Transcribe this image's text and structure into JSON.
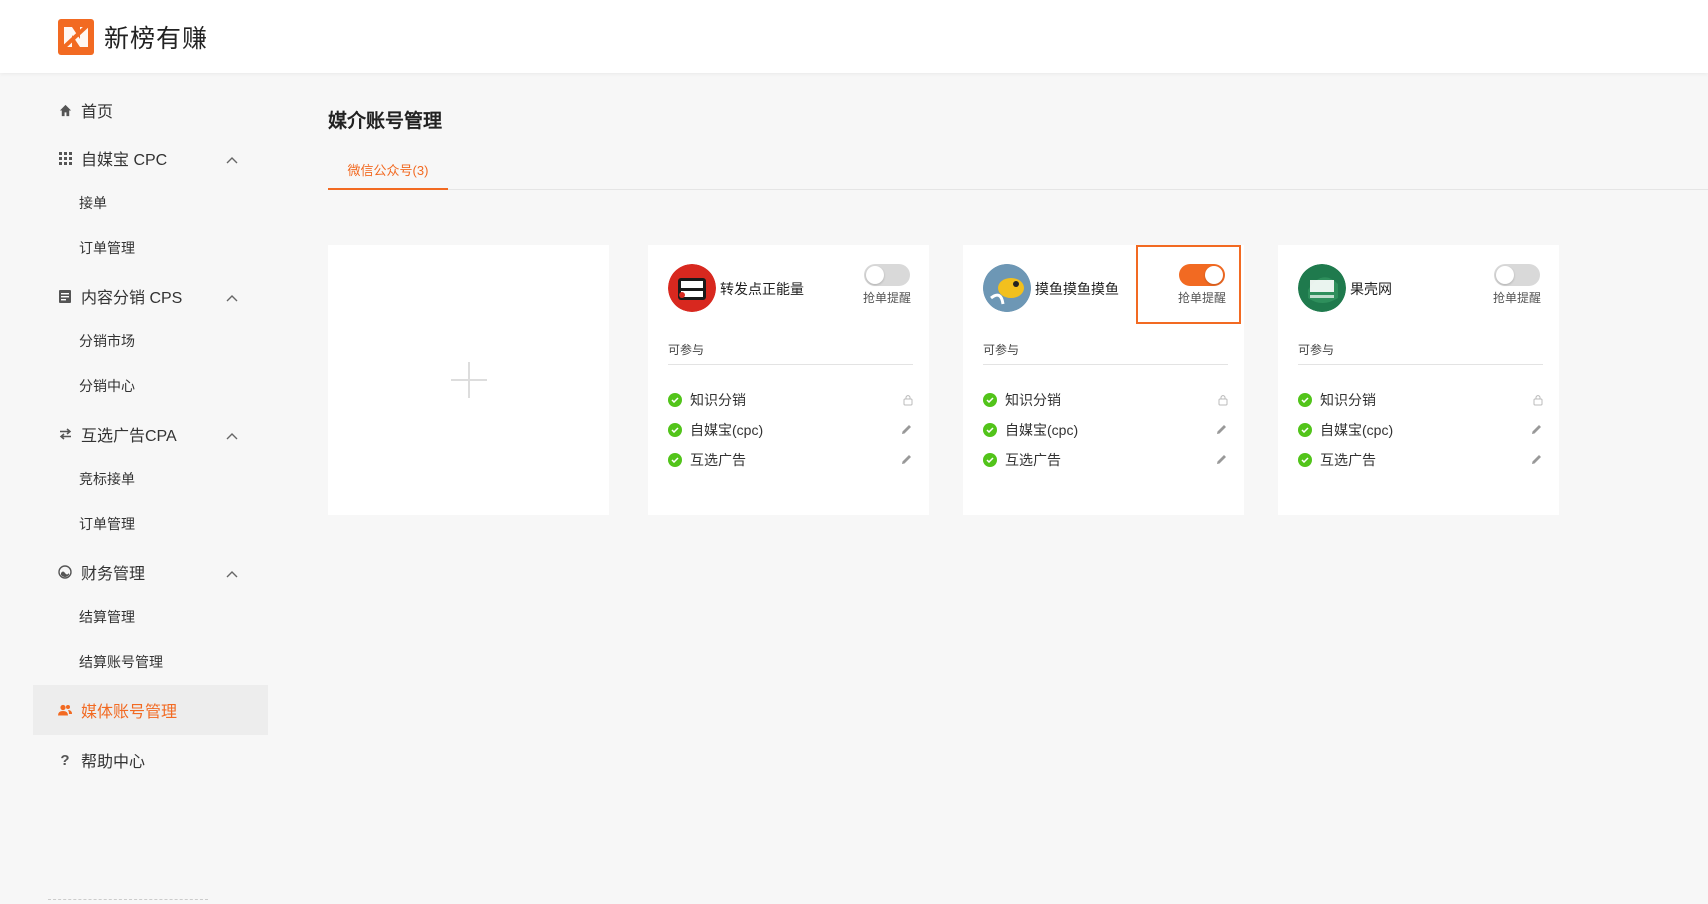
{
  "app": {
    "name": "新榜有赚"
  },
  "colors": {
    "accent": "#f26a22",
    "check": "#52c41a",
    "toggle_off": "#d9d9d9"
  },
  "sidebar": {
    "home": "首页",
    "groups": [
      {
        "label": "自媒宝 CPC",
        "icon": "grid-icon",
        "items": [
          "接单",
          "订单管理"
        ]
      },
      {
        "label": "内容分销 CPS",
        "icon": "document-icon",
        "items": [
          "分销市场",
          "分销中心"
        ]
      },
      {
        "label": "互选广告CPA",
        "icon": "swap-icon",
        "items": [
          "竞标接单",
          "订单管理"
        ]
      },
      {
        "label": "财务管理",
        "icon": "wallet-icon",
        "items": [
          "结算管理",
          "结算账号管理"
        ]
      }
    ],
    "active": "媒体账号管理",
    "help": "帮助中心"
  },
  "main": {
    "title": "媒介账号管理",
    "tab": "微信公众号(3)",
    "cards": [
      {
        "name": "转发点正能量",
        "avatar": "red-badge-avatar",
        "toggle_on": false,
        "toggle_label": "抢单提醒",
        "section": "可参与",
        "features": [
          {
            "label": "知识分销",
            "action": "lock-icon"
          },
          {
            "label": "自媒宝(cpc)",
            "action": "pencil-icon"
          },
          {
            "label": "互选广告",
            "action": "pencil-icon"
          }
        ]
      },
      {
        "name": "摸鱼摸鱼摸鱼",
        "avatar": "fish-avatar",
        "toggle_on": true,
        "toggle_label": "抢单提醒",
        "section": "可参与",
        "features": [
          {
            "label": "知识分销",
            "action": "lock-icon"
          },
          {
            "label": "自媒宝(cpc)",
            "action": "pencil-icon"
          },
          {
            "label": "互选广告",
            "action": "pencil-icon"
          }
        ]
      },
      {
        "name": "果壳网",
        "avatar": "guoke-avatar",
        "toggle_on": false,
        "toggle_label": "抢单提醒",
        "section": "可参与",
        "features": [
          {
            "label": "知识分销",
            "action": "lock-icon"
          },
          {
            "label": "自媒宝(cpc)",
            "action": "pencil-icon"
          },
          {
            "label": "互选广告",
            "action": "pencil-icon"
          }
        ]
      }
    ]
  }
}
